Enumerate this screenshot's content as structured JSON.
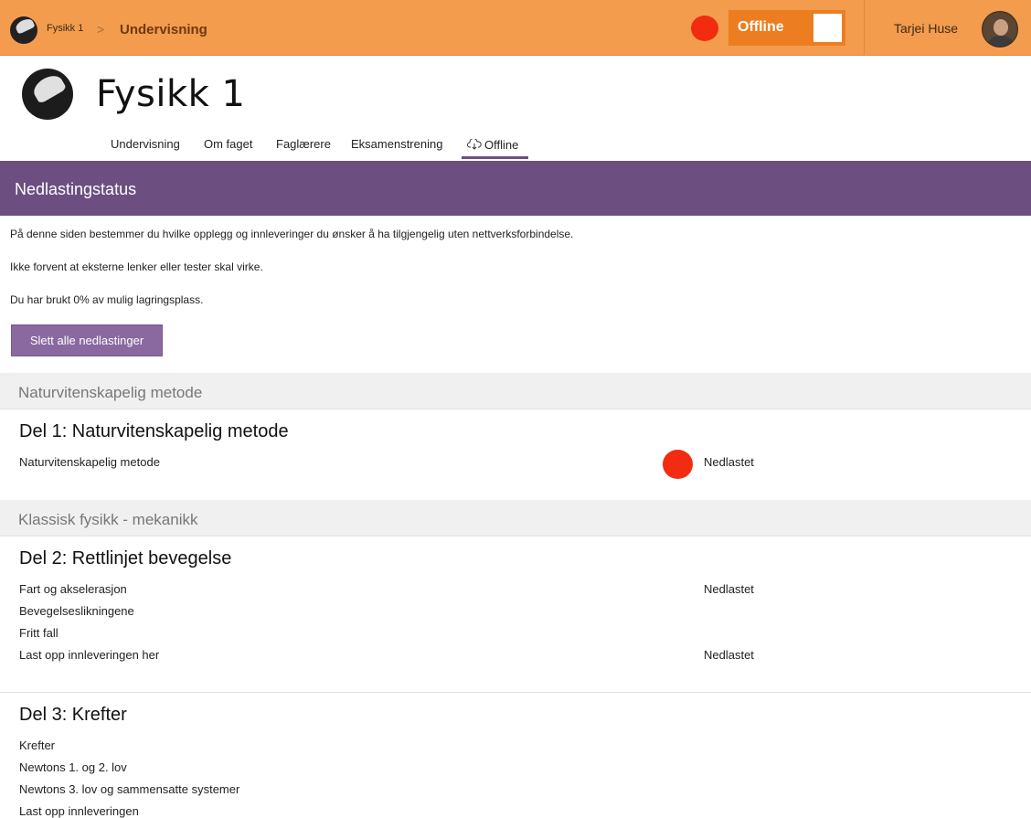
{
  "topbar": {
    "course_name": "Fysikk 1",
    "breadcrumb_separator": ">",
    "current_page": "Undervisning",
    "offline_label": "Offline",
    "user_name": "Tarjei Huse",
    "accent_color": "#f39c4d",
    "status_dot_color": "#f22c10"
  },
  "course": {
    "title": "Fysikk 1"
  },
  "nav": {
    "items": [
      {
        "label": "Undervisning"
      },
      {
        "label": "Om faget"
      },
      {
        "label": "Faglærere"
      },
      {
        "label": "Eksamenstrening"
      },
      {
        "label": "Offline",
        "icon": "cloud-download-icon",
        "active": true
      }
    ]
  },
  "page": {
    "header": "Nedlastingstatus",
    "header_color": "#6d4e81",
    "info_lines": [
      "På denne siden bestemmer du hvilke opplegg og innleveringer du ønsker å ha tilgjengelig uten nettverksforbindelse.",
      "Ikke forvent at eksterne lenker eller tester skal virke.",
      "Du har brukt 0% av mulig lagringsplass."
    ],
    "delete_button": "Slett alle nedlastinger"
  },
  "sections": [
    {
      "name": "Naturvitenskapelig metode",
      "parts": [
        {
          "title": "Del 1: Naturvitenskapelig metode",
          "items": [
            {
              "label": "Naturvitenskapelig metode",
              "status": "Nedlastet"
            }
          ]
        }
      ]
    },
    {
      "name": "Klassisk fysikk - mekanikk",
      "parts": [
        {
          "title": "Del 2: Rettlinjet bevegelse",
          "items": [
            {
              "label": "Fart og akselerasjon",
              "status": "Nedlastet"
            },
            {
              "label": "Bevegelseslikningene",
              "status": ""
            },
            {
              "label": "Fritt fall",
              "status": ""
            },
            {
              "label": "Last opp innleveringen her",
              "status": "Nedlastet"
            }
          ]
        },
        {
          "title": "Del 3: Krefter",
          "items": [
            {
              "label": "Krefter"
            },
            {
              "label": "Newtons 1. og 2. lov"
            },
            {
              "label": "Newtons 3. lov og sammensatte systemer"
            },
            {
              "label": "Last opp innleveringen"
            }
          ]
        }
      ]
    }
  ]
}
